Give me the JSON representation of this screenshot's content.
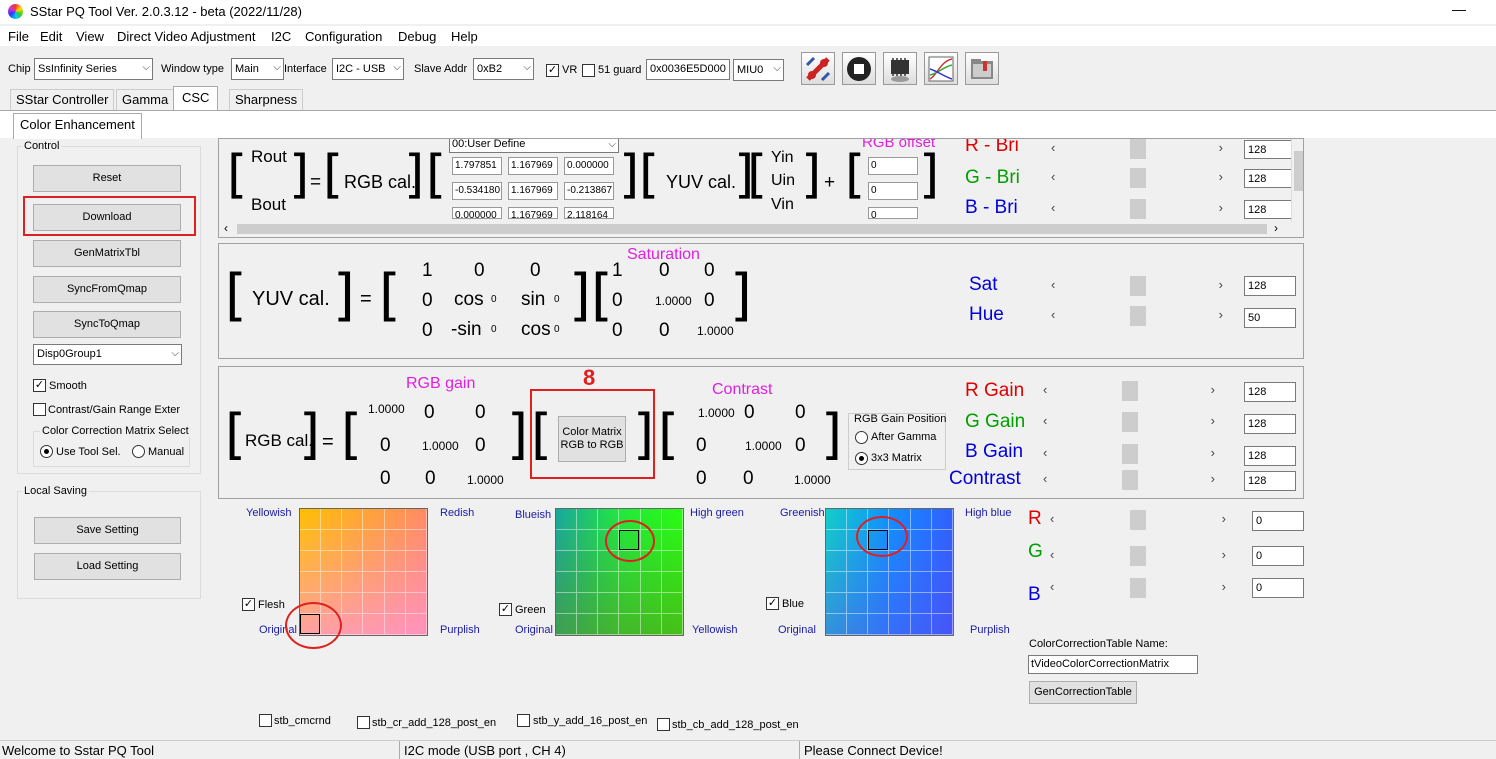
{
  "window": {
    "title": "SStar PQ Tool Ver. 2.0.3.12 - beta (2022/11/28)",
    "minimize": "—"
  },
  "menu": [
    "File",
    "Edit",
    "View",
    "Direct Video Adjustment",
    "I2C",
    "Configuration",
    "Debug",
    "Help"
  ],
  "toolbar": {
    "chip_label": "Chip",
    "chip_value": "SsInfinity Series",
    "window_type_label": "Window type",
    "window_type_value": "Main",
    "interface_label": "Interface",
    "interface_value": "I2C - USB",
    "slave_label": "Slave Addr",
    "slave_value": "0xB2",
    "vr_label": "VR",
    "vr_checked": "✓",
    "guard_label": "51 guard",
    "address_value": "0x0036E5D000",
    "miu_value": "MIU0"
  },
  "tabs": [
    "SStar Controller",
    "Gamma",
    "CSC",
    "Sharpness"
  ],
  "subtab": "Color Enhancement",
  "control": {
    "title": "Control",
    "reset": "Reset",
    "download": "Download",
    "genmatrix": "GenMatrixTbl",
    "syncfrom": "SyncFromQmap",
    "syncto": "SyncToQmap",
    "group_value": "Disp0Group1",
    "smooth_label": "Smooth",
    "smooth_checked": "✓",
    "contrast_label": "Contrast/Gain Range Exter",
    "ccm_title": "Color Correction Matrix Select",
    "use_tool": "Use Tool Sel.",
    "manual": "Manual"
  },
  "local": {
    "title": "Local Saving",
    "save": "Save Setting",
    "load": "Load Setting"
  },
  "rgbcal": {
    "rout": "Rout",
    "bout": "Bout",
    "label": "RGB cal.",
    "define_value": "00:User Define",
    "matrix": [
      [
        "1.797851",
        "1.167969",
        "0.000000"
      ],
      [
        "-0.534180",
        "1.167969",
        "-0.213867"
      ],
      [
        "0.000000",
        "1.167969",
        "2.118164"
      ]
    ],
    "yuv_label": "YUV cal.",
    "yin": "Yin",
    "uin": "Uin",
    "vin": "Vin",
    "plus": "+",
    "offset_title": "RGB offset",
    "offsets": [
      "0",
      "0",
      "0"
    ],
    "sliders": [
      {
        "label": "R - Bri",
        "color": "#e00000",
        "value": "128"
      },
      {
        "label": "G - Bri",
        "color": "#00a000",
        "value": "128"
      },
      {
        "label": "B - Bri",
        "color": "#0000dd",
        "value": "128"
      }
    ]
  },
  "saturation": {
    "yuv_label": "YUV cal.",
    "title": "Saturation",
    "rot": [
      [
        "1",
        "0",
        "0"
      ],
      [
        "0",
        "cos",
        "sin"
      ],
      [
        "0",
        "-sin",
        "cos"
      ]
    ],
    "sub0": "0",
    "sat_matrix": [
      [
        "1",
        "0",
        "0"
      ],
      [
        "0",
        "1.0000",
        "0"
      ],
      [
        "0",
        "0",
        "1.0000"
      ]
    ],
    "sliders": [
      {
        "label": "Sat",
        "value": "128"
      },
      {
        "label": "Hue",
        "value": "50"
      }
    ]
  },
  "gain": {
    "label": "RGB cal.",
    "gain_title": "RGB gain",
    "gain_matrix": [
      [
        "1.0000",
        "0",
        "0"
      ],
      [
        "0",
        "1.0000",
        "0"
      ],
      [
        "0",
        "0",
        "1.0000"
      ]
    ],
    "annotation": "8",
    "color_matrix_btn": "Color Matrix\nRGB to RGB",
    "contrast_title": "Contrast",
    "contrast_matrix": [
      [
        "1.0000",
        "0",
        "0"
      ],
      [
        "0",
        "1.0000",
        "0"
      ],
      [
        "0",
        "0",
        "1.0000"
      ]
    ],
    "position_title": "RGB Gain Position",
    "after_gamma": "After Gamma",
    "matrix_3x3": "3x3 Matrix",
    "sliders": [
      {
        "label": "R Gain",
        "color": "#e00000",
        "value": "128"
      },
      {
        "label": "G Gain",
        "color": "#00a000",
        "value": "128"
      },
      {
        "label": "B Gain",
        "color": "#0000dd",
        "value": "128"
      },
      {
        "label": "Contrast",
        "color": "#0000dd",
        "value": "128"
      }
    ]
  },
  "grids": [
    {
      "tl": "Yellowish",
      "tr": "Redish",
      "bl": "Original",
      "br": "Purplish",
      "check": "Flesh"
    },
    {
      "tl": "Blueish",
      "tr": "High green",
      "bl": "Original",
      "br": "Yellowish",
      "check": "Green"
    },
    {
      "tl": "Greenish",
      "tr": "High blue",
      "bl": "Original",
      "br": "Purplish",
      "check": "Blue"
    }
  ],
  "rgb_sliders": [
    {
      "label": "R",
      "color": "#e00000",
      "value": "0"
    },
    {
      "label": "G",
      "color": "#00a000",
      "value": "0"
    },
    {
      "label": "B",
      "color": "#0000dd",
      "value": "0"
    }
  ],
  "cct": {
    "name_label": "ColorCorrectionTable Name:",
    "name_value": "tVideoColorCorrectionMatrix",
    "gen_button": "GenCorrectionTable"
  },
  "bottom_checks": [
    "stb_cmcrnd",
    "stb_cr_add_128_post_en",
    "stb_y_add_16_post_en",
    "stb_cb_add_128_post_en"
  ],
  "status": {
    "left": "Welcome to Sstar PQ Tool",
    "mid": "I2C mode (USB port , CH 4)",
    "right": "Please Connect Device!"
  }
}
